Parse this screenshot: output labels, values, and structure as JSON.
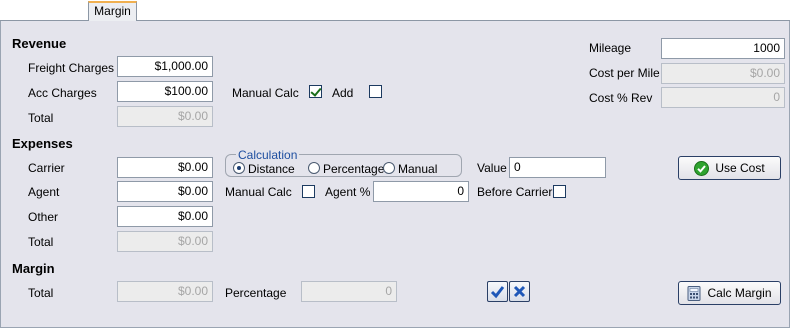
{
  "tab": {
    "label": "Margin"
  },
  "revenue": {
    "heading": "Revenue",
    "freight_label": "Freight Charges",
    "freight_value": "$1,000.00",
    "acc_label": "Acc Charges",
    "acc_value": "$100.00",
    "total_label": "Total",
    "total_value": "$0.00",
    "manual_calc_label": "Manual Calc",
    "manual_calc_checked": true,
    "add_label": "Add",
    "add_checked": false
  },
  "stats": {
    "mileage_label": "Mileage",
    "mileage_value": "1000",
    "cpm_label": "Cost per Mile",
    "cpm_value": "$0.00",
    "cost_pct_label": "Cost % Rev",
    "cost_pct_value": "0"
  },
  "expenses": {
    "heading": "Expenses",
    "carrier_label": "Carrier",
    "carrier_value": "$0.00",
    "agent_label": "Agent",
    "agent_value": "$0.00",
    "other_label": "Other",
    "other_value": "$0.00",
    "total_label": "Total",
    "total_value": "$0.00",
    "calculation": {
      "title": "Calculation",
      "options": [
        "Distance",
        "Percentage",
        "Manual"
      ],
      "selected": "Distance"
    },
    "value_label": "Value",
    "value_value": "0",
    "manual_calc_label": "Manual Calc",
    "agent_pct_label": "Agent %",
    "agent_pct_value": "0",
    "before_carrier_label": "Before Carrier",
    "use_cost_label": "Use Cost"
  },
  "margin": {
    "heading": "Margin",
    "total_label": "Total",
    "total_value": "$0.00",
    "percentage_label": "Percentage",
    "percentage_value": "0",
    "calc_margin_label": "Calc Margin"
  }
}
